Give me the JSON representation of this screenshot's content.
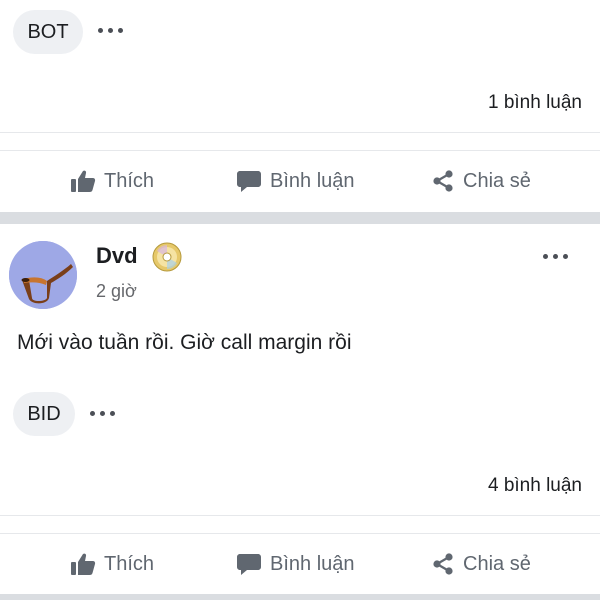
{
  "posts": [
    {
      "reaction_chip": "BOT",
      "comment_count": "1 bình luận",
      "actions": {
        "like": "Thích",
        "comment": "Bình luận",
        "share": "Chia sẻ"
      }
    },
    {
      "author": "Dvd",
      "time": "2 giờ",
      "text": "Mới vào tuần rồi. Giờ call margin rồi",
      "reaction_chip": "BID",
      "comment_count": "4 bình luận",
      "actions": {
        "like": "Thích",
        "comment": "Bình luận",
        "share": "Chia sẻ"
      }
    }
  ],
  "icons": {
    "more": "more-dots-icon",
    "like": "thumbs-up-icon",
    "comment": "speech-bubble-icon",
    "share": "share-icon",
    "badge": "cd-disc-icon",
    "avatar": "pipe-avatar"
  },
  "colors": {
    "action_text": "#606770",
    "separator": "#dadde1",
    "chip_bg": "#eef0f3",
    "avatar_bg": "#9ea8e6"
  }
}
